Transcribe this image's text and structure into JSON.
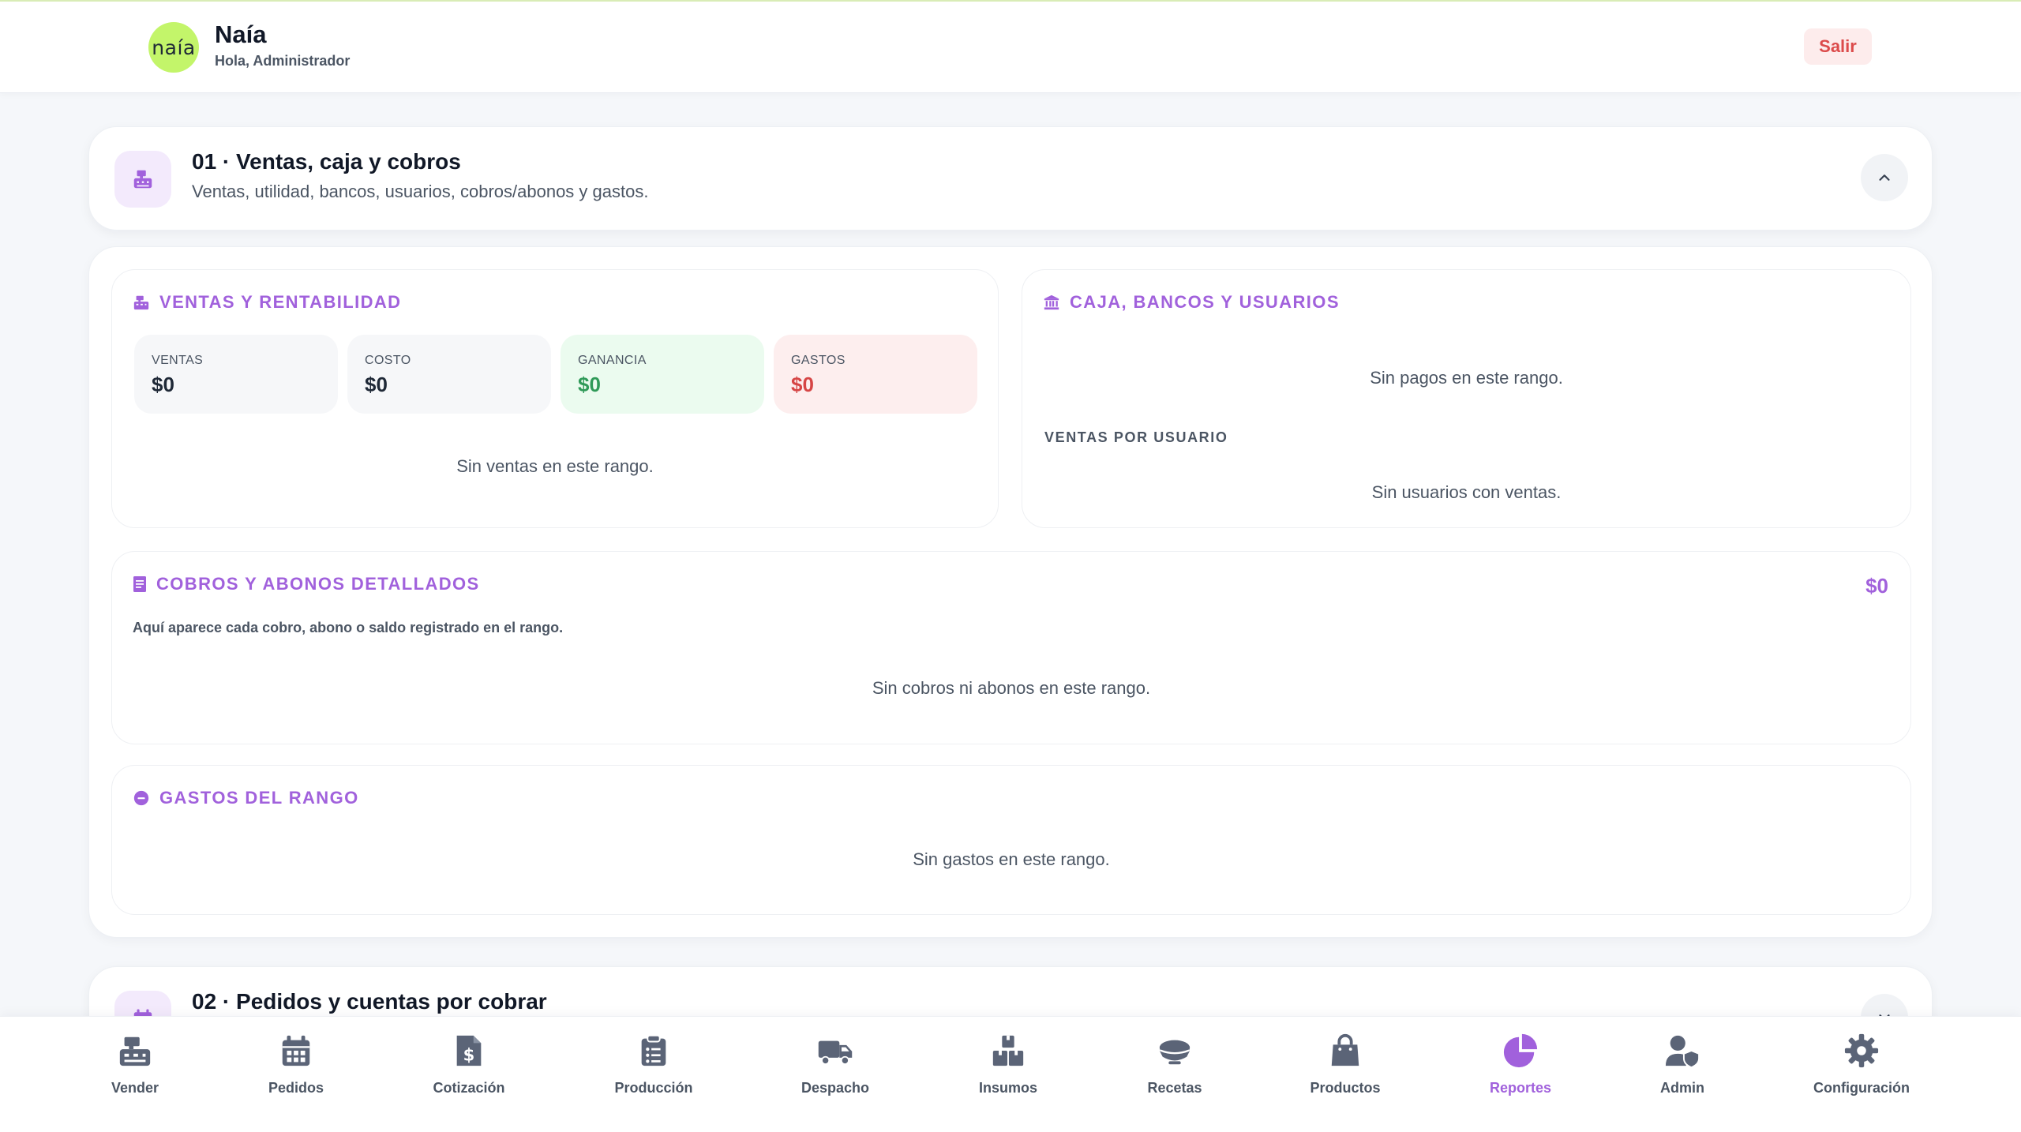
{
  "header": {
    "logo_text": "naía",
    "app_name": "Naía",
    "greeting": "Hola, Administrador",
    "logout_label": "Salir"
  },
  "section1": {
    "title": "01 · Ventas, caja y cobros",
    "description": "Ventas, utilidad, bancos, usuarios, cobros/abonos y gastos.",
    "icon": "cash-register-icon"
  },
  "sales_panel": {
    "title": "VENTAS Y RENTABILIDAD",
    "stats": [
      {
        "label": "VENTAS",
        "value": "$0"
      },
      {
        "label": "COSTO",
        "value": "$0"
      },
      {
        "label": "GANANCIA",
        "value": "$0"
      },
      {
        "label": "GASTOS",
        "value": "$0"
      }
    ],
    "empty_text": "Sin ventas en este rango."
  },
  "cash_panel": {
    "title": "CAJA, BANCOS Y USUARIOS",
    "empty_payments": "Sin pagos en este rango.",
    "users_heading": "VENTAS POR USUARIO",
    "empty_users": "Sin usuarios con ventas."
  },
  "collections_panel": {
    "title": "COBROS Y ABONOS DETALLADOS",
    "total": "$0",
    "note": "Aquí aparece cada cobro, abono o saldo registrado en el rango.",
    "empty_text": "Sin cobros ni abonos en este rango."
  },
  "expenses_panel": {
    "title": "GASTOS DEL RANGO",
    "empty_text": "Sin gastos en este rango."
  },
  "section2": {
    "title": "02 · Pedidos y cuentas por cobrar"
  },
  "colors": {
    "accent": "#a161dc",
    "brand": "#c3f56a",
    "danger": "#d64545",
    "success": "#2f9a58",
    "nav_icon": "#5b6477"
  },
  "nav": [
    {
      "label": "Vender",
      "icon": "cash-register-icon"
    },
    {
      "label": "Pedidos",
      "icon": "calendar-icon"
    },
    {
      "label": "Cotización",
      "icon": "invoice-dollar-icon"
    },
    {
      "label": "Producción",
      "icon": "clipboard-list-icon"
    },
    {
      "label": "Despacho",
      "icon": "delivery-truck-icon"
    },
    {
      "label": "Insumos",
      "icon": "boxes-icon"
    },
    {
      "label": "Recetas",
      "icon": "bowl-icon"
    },
    {
      "label": "Productos",
      "icon": "shopping-bag-icon"
    },
    {
      "label": "Reportes",
      "icon": "pie-chart-icon",
      "active": true
    },
    {
      "label": "Admin",
      "icon": "user-shield-icon"
    },
    {
      "label": "Configuración",
      "icon": "gear-icon"
    }
  ]
}
